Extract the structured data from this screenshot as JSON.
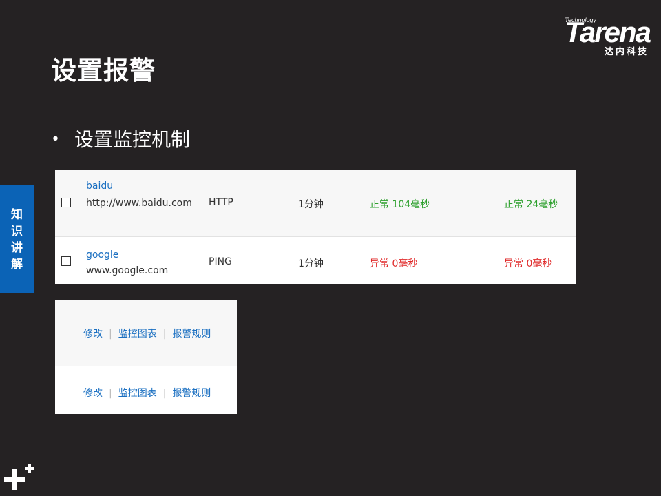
{
  "slide": {
    "title": "设置报警",
    "bullet": "设置监控机制",
    "side_tab": [
      "知",
      "识",
      "讲",
      "解"
    ]
  },
  "logo": {
    "tagline": "Technology",
    "brand": "Tarena",
    "cn": "达内科技"
  },
  "monitor_table": {
    "rows": [
      {
        "name": "baidu",
        "url": "http://www.baidu.com",
        "protocol": "HTTP",
        "frequency": "1分钟",
        "status1": "正常 104毫秒",
        "status2": "正常 24毫秒",
        "status_state": "ok"
      },
      {
        "name": "google",
        "url": "www.google.com",
        "protocol": "PING",
        "frequency": "1分钟",
        "status1": "异常 0毫秒",
        "status2": "异常 0毫秒",
        "status_state": "error"
      }
    ]
  },
  "operations": {
    "rows": [
      {
        "edit": "修改",
        "chart": "监控图表",
        "alert_rules": "报警规则"
      },
      {
        "edit": "修改",
        "chart": "监控图表",
        "alert_rules": "报警规则"
      }
    ],
    "separator": "|"
  },
  "colors": {
    "background": "#252223",
    "accent_blue": "#0b63b6",
    "link_blue": "#1a6fc1",
    "ok_green": "#2ea02e",
    "error_red": "#e02a2a"
  }
}
